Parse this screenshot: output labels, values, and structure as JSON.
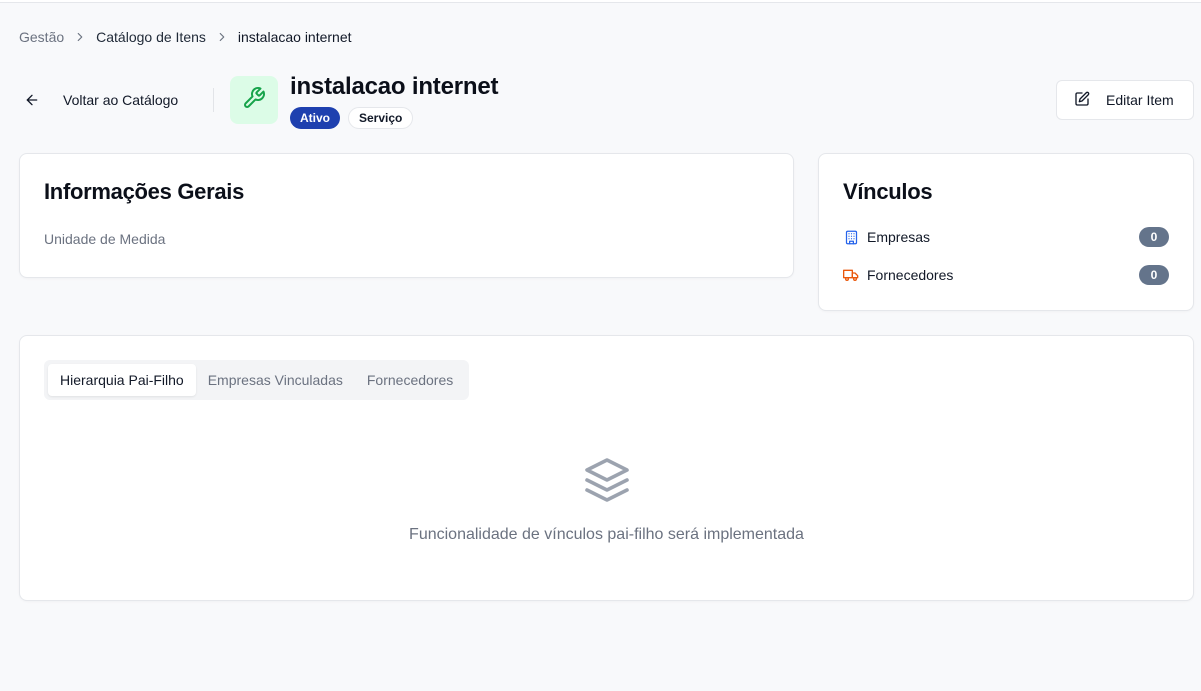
{
  "breadcrumb": {
    "items": [
      "Gestão",
      "Catálogo de Itens",
      "instalacao internet"
    ]
  },
  "header": {
    "back_label": "Voltar ao Catálogo",
    "title": "instalacao internet",
    "status_badge": "Ativo",
    "type_badge": "Serviço",
    "edit_label": "Editar Item",
    "item_icon": "wrench-icon"
  },
  "info_card": {
    "title": "Informações Gerais",
    "field_label": "Unidade de Medida"
  },
  "links_card": {
    "title": "Vínculos",
    "rows": [
      {
        "label": "Empresas",
        "count": "0",
        "icon": "building-icon"
      },
      {
        "label": "Fornecedores",
        "count": "0",
        "icon": "truck-icon"
      }
    ]
  },
  "tabs": {
    "items": [
      "Hierarquia Pai-Filho",
      "Empresas Vinculadas",
      "Fornecedores"
    ],
    "active": "Hierarquia Pai-Filho"
  },
  "empty_state": {
    "icon": "layers-icon",
    "message": "Funcionalidade de vínculos pai-filho será implementada"
  },
  "colors": {
    "accent": "#1e40af",
    "success_bg": "#dcfce7",
    "success_icon": "#16a34a",
    "building_icon": "#2563eb",
    "truck_icon": "#ea580c",
    "count_badge": "#64748b"
  }
}
